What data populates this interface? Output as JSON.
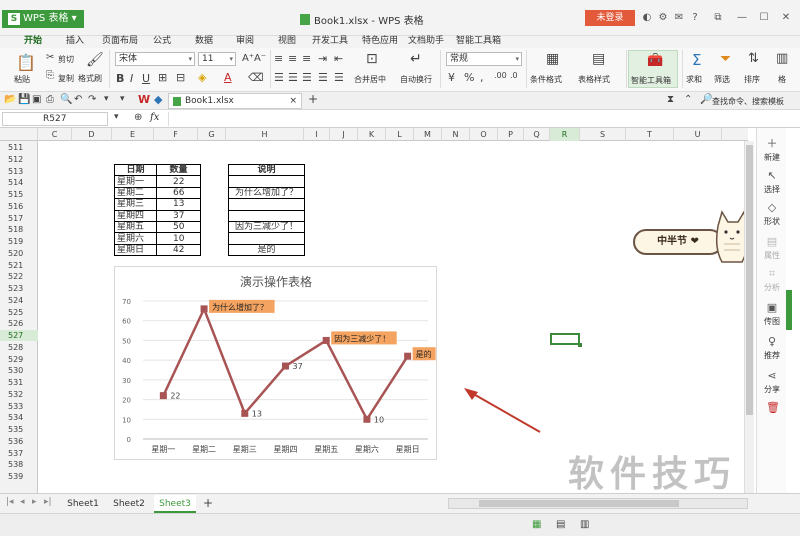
{
  "title_bar": {
    "app_label": "WPS 表格",
    "window_title": "Book1.xlsx - WPS 表格",
    "login_label": "未登录"
  },
  "menu_tabs": [
    "开始",
    "插入",
    "页面布局",
    "公式",
    "数据",
    "审阅",
    "视图",
    "开发工具",
    "特色应用",
    "文档助手",
    "智能工具箱"
  ],
  "ribbon": {
    "paste": "粘贴",
    "cut": "剪切",
    "copy": "复制",
    "format_painter": "格式刷",
    "font_name": "宋体",
    "font_size": "11",
    "merge_center": "合并居中",
    "wrap_text": "自动换行",
    "number_format": "常规",
    "cond_format": "条件格式",
    "table_style": "表格样式",
    "smart_toolbox": "智能工具箱",
    "sum": "求和",
    "filter": "筛选",
    "sort": "排序",
    "format": "格"
  },
  "quick_bar": {
    "doc_tab": "Book1.xlsx",
    "search": "查找命令、搜索模板"
  },
  "formula_bar": {
    "name_box": "R527",
    "fx": "fx"
  },
  "columns": [
    "C",
    "D",
    "E",
    "F",
    "G",
    "H",
    "I",
    "J",
    "K",
    "L",
    "M",
    "N",
    "O",
    "P",
    "Q",
    "R",
    "S",
    "T",
    "U"
  ],
  "rows": [
    "511",
    "512",
    "513",
    "514",
    "515",
    "516",
    "517",
    "518",
    "519",
    "520",
    "521",
    "522",
    "523",
    "524",
    "525",
    "526",
    "527",
    "528",
    "529",
    "530",
    "531",
    "532",
    "533",
    "534",
    "535",
    "536",
    "537",
    "538",
    "539"
  ],
  "active_row": "527",
  "active_col": "R",
  "table": {
    "headers": [
      "日期",
      "数量",
      "",
      "说明"
    ],
    "rows": [
      [
        "星期一",
        "22",
        "",
        ""
      ],
      [
        "星期二",
        "66",
        "",
        "为什么增加了？"
      ],
      [
        "星期三",
        "13",
        "",
        ""
      ],
      [
        "星期四",
        "37",
        "",
        ""
      ],
      [
        "星期五",
        "50",
        "",
        "因为三减少了！"
      ],
      [
        "星期六",
        "10",
        "",
        ""
      ],
      [
        "星期日",
        "42",
        "",
        "是的"
      ]
    ]
  },
  "chart_data": {
    "type": "line",
    "title": "演示操作表格",
    "categories": [
      "星期一",
      "星期二",
      "星期三",
      "星期四",
      "星期五",
      "星期六",
      "星期日"
    ],
    "values": [
      22,
      66,
      13,
      37,
      50,
      10,
      42
    ],
    "labels": [
      "22",
      "为什么增加了？",
      "13",
      "37",
      "因为三减少了！",
      "10",
      "是的"
    ],
    "ylim": [
      0,
      70
    ],
    "yticks": [
      0,
      10,
      20,
      30,
      40,
      50,
      60,
      70
    ],
    "grid": true,
    "line_color": "#a85454",
    "callout_color": "#f4a460"
  },
  "side_panel": [
    {
      "label": "新建",
      "icon": "plus-icon"
    },
    {
      "label": "选择",
      "icon": "cursor-icon"
    },
    {
      "label": "形状",
      "icon": "shape-icon"
    },
    {
      "label": "属性",
      "icon": "property-icon"
    },
    {
      "label": "分析",
      "icon": "analysis-icon"
    },
    {
      "label": "传图",
      "icon": "image-icon"
    },
    {
      "label": "推荐",
      "icon": "lightbulb-icon"
    },
    {
      "label": "分享",
      "icon": "share-icon"
    }
  ],
  "sheets": [
    "Sheet1",
    "Sheet2",
    "Sheet3"
  ],
  "active_sheet": "Sheet3",
  "sticker_text": "中半节 ❤",
  "watermark": "软件技巧",
  "colors": {
    "accent": "#3c9a3c",
    "login": "#e35a3b",
    "arrow": "#c0392b"
  }
}
